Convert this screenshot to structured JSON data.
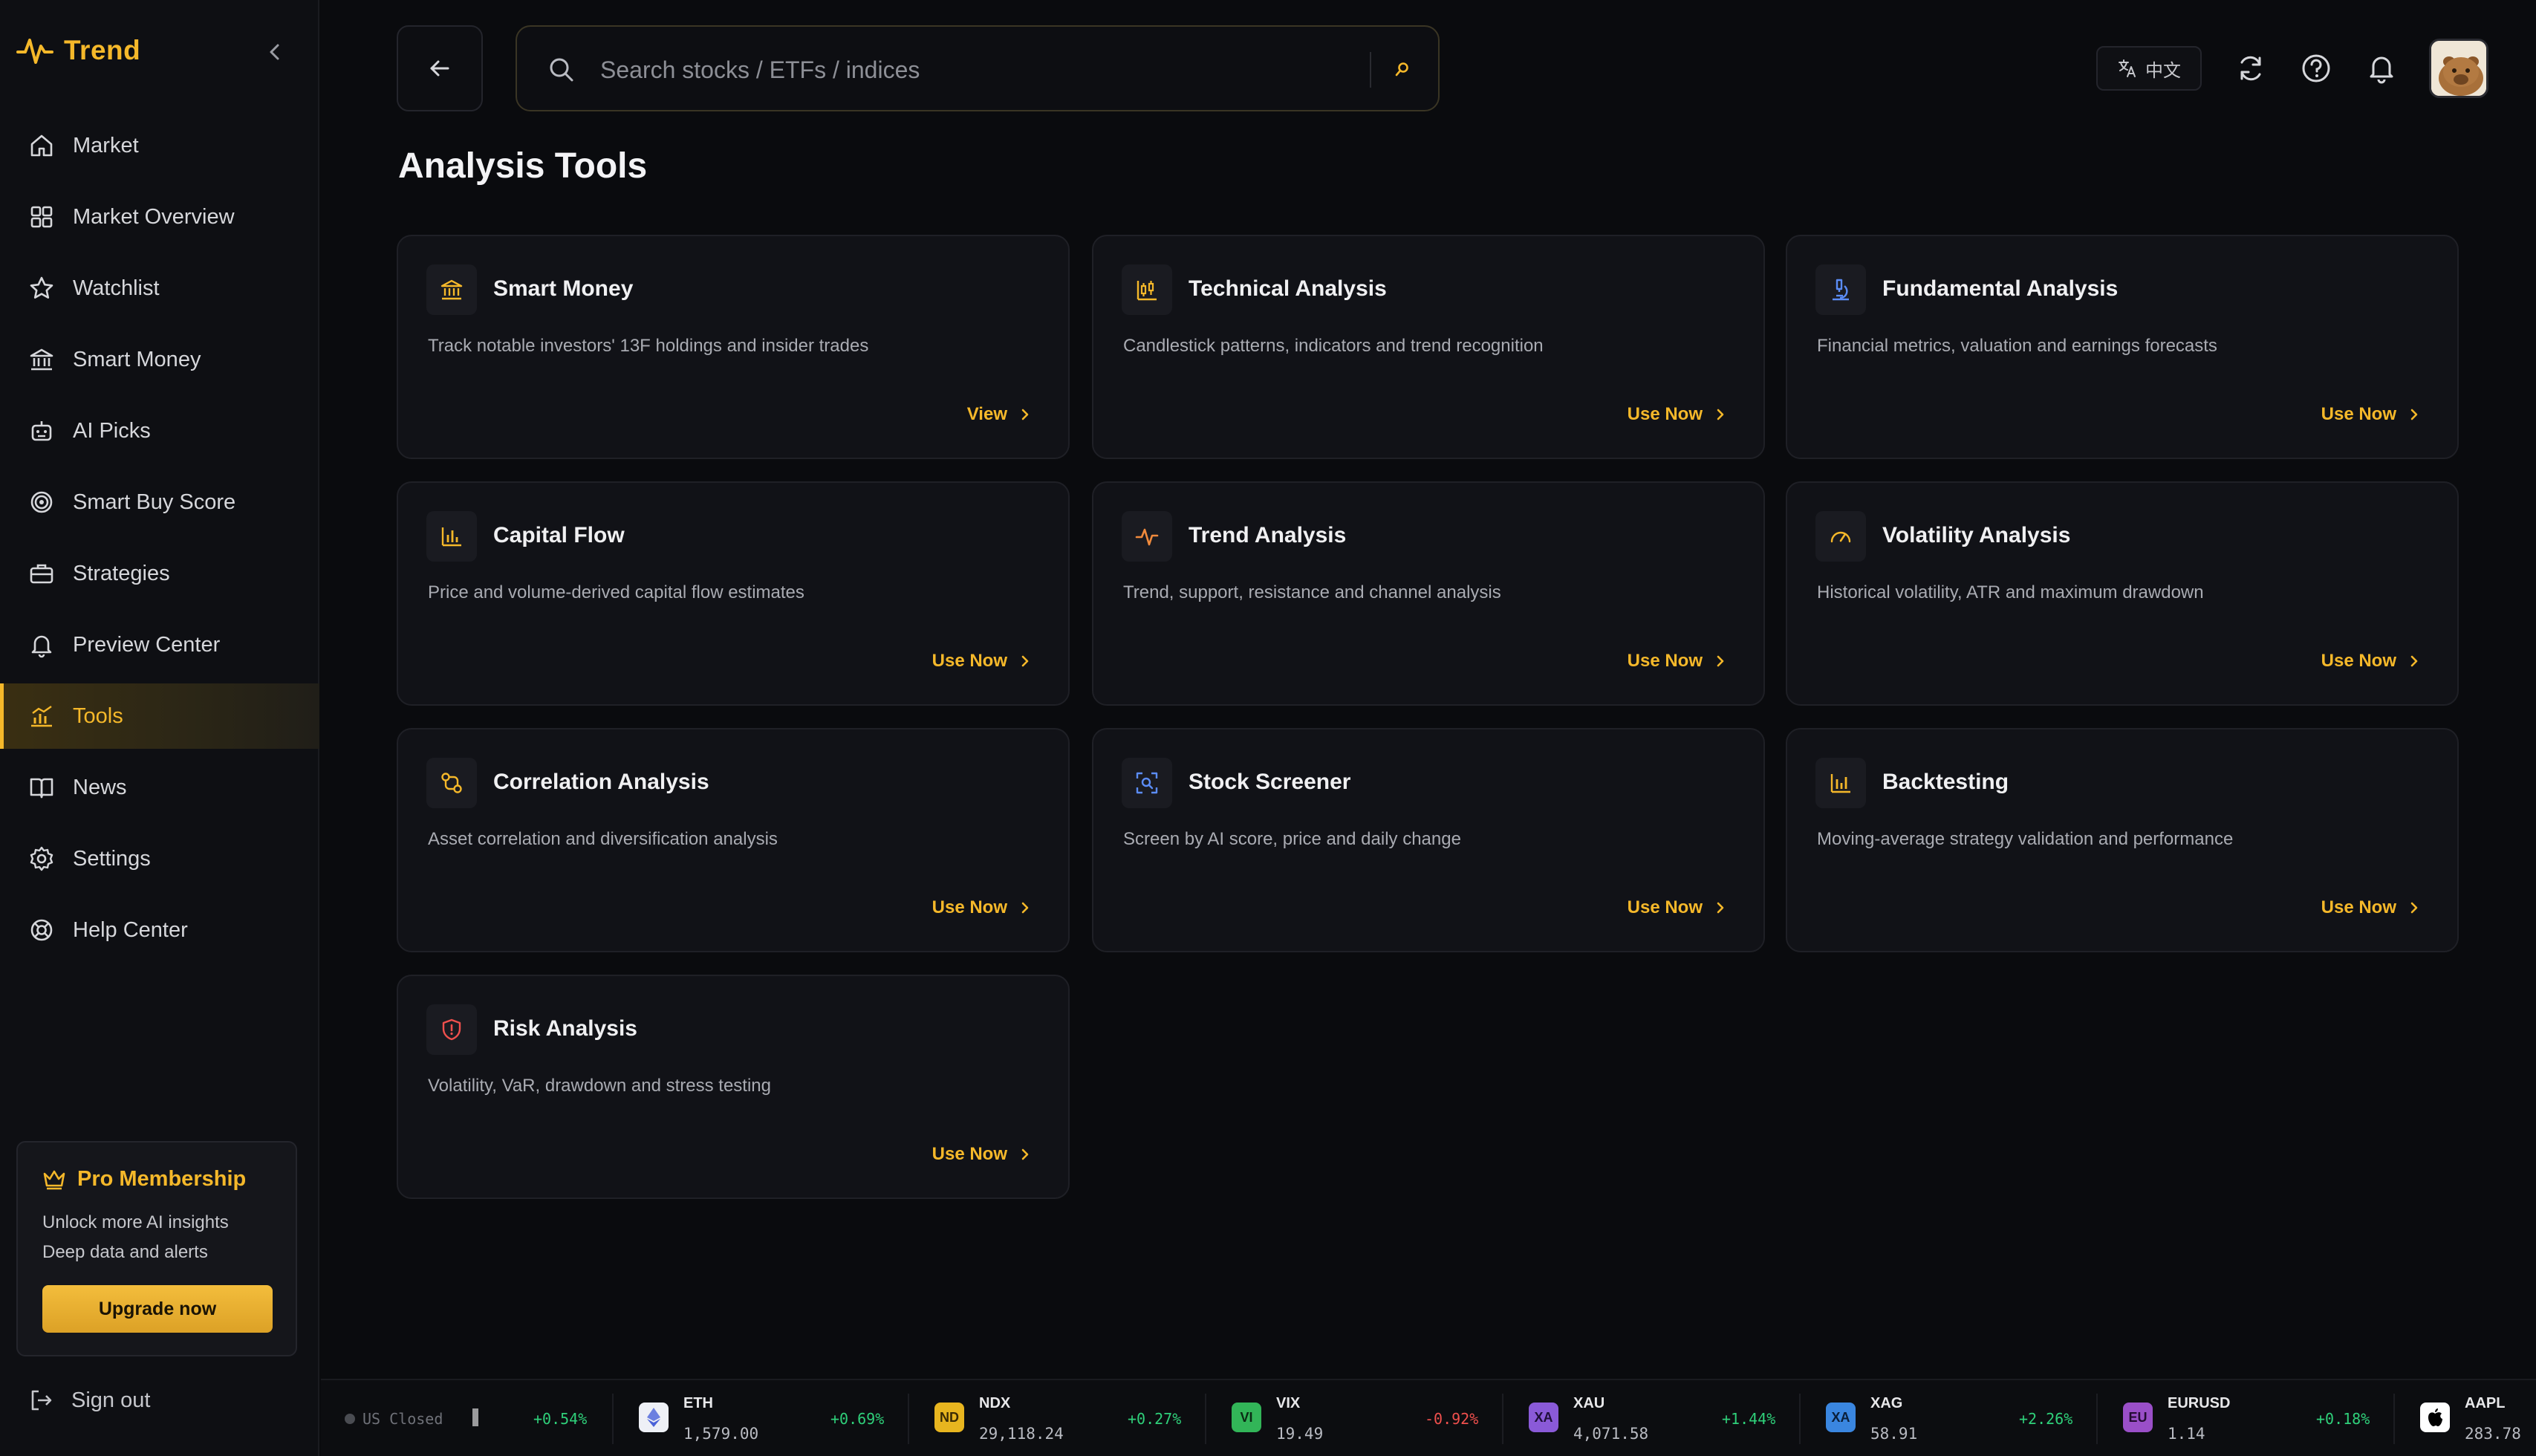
{
  "app": {
    "name": "Trend"
  },
  "sidebar": {
    "items": [
      {
        "label": "Market",
        "icon": "home-icon"
      },
      {
        "label": "Market Overview",
        "icon": "grid-icon"
      },
      {
        "label": "Watchlist",
        "icon": "star-icon"
      },
      {
        "label": "Smart Money",
        "icon": "bank-icon"
      },
      {
        "label": "AI Picks",
        "icon": "robot-icon"
      },
      {
        "label": "Smart Buy Score",
        "icon": "target-icon"
      },
      {
        "label": "Strategies",
        "icon": "briefcase-icon"
      },
      {
        "label": "Preview Center",
        "icon": "bell-icon"
      },
      {
        "label": "Tools",
        "icon": "chart-icon",
        "active": true
      },
      {
        "label": "News",
        "icon": "book-icon"
      },
      {
        "label": "Settings",
        "icon": "gear-icon"
      },
      {
        "label": "Help Center",
        "icon": "lifebuoy-icon"
      }
    ],
    "pro": {
      "title": "Pro Membership",
      "line1": "Unlock more AI insights",
      "line2": "Deep data and alerts",
      "button": "Upgrade now"
    },
    "signout": "Sign out"
  },
  "header": {
    "search_placeholder": "Search stocks / ETFs / indices",
    "lang_label": "中文"
  },
  "page": {
    "title": "Analysis Tools"
  },
  "tools": [
    {
      "title": "Smart Money",
      "desc": "Track notable investors' 13F holdings and insider trades",
      "action": "View",
      "icon": "bank-icon",
      "color": "#f5b82a"
    },
    {
      "title": "Technical Analysis",
      "desc": "Candlestick patterns, indicators and trend recognition",
      "action": "Use Now",
      "icon": "candlestick-icon",
      "color": "#f5b82a"
    },
    {
      "title": "Fundamental Analysis",
      "desc": "Financial metrics, valuation and earnings forecasts",
      "action": "Use Now",
      "icon": "microscope-icon",
      "color": "#5b8cf5"
    },
    {
      "title": "Capital Flow",
      "desc": "Price and volume-derived capital flow estimates",
      "action": "Use Now",
      "icon": "bar-chart-icon",
      "color": "#f5b82a"
    },
    {
      "title": "Trend Analysis",
      "desc": "Trend, support, resistance and channel analysis",
      "action": "Use Now",
      "icon": "pulse-icon",
      "color": "#f08a3c"
    },
    {
      "title": "Volatility Analysis",
      "desc": "Historical volatility, ATR and maximum drawdown",
      "action": "Use Now",
      "icon": "gauge-icon",
      "color": "#f5b82a"
    },
    {
      "title": "Correlation Analysis",
      "desc": "Asset correlation and diversification analysis",
      "action": "Use Now",
      "icon": "link-icon",
      "color": "#f5b82a"
    },
    {
      "title": "Stock Screener",
      "desc": "Screen by AI score, price and daily change",
      "action": "Use Now",
      "icon": "scan-icon",
      "color": "#5b8cf5"
    },
    {
      "title": "Backtesting",
      "desc": "Moving-average strategy validation and performance",
      "action": "Use Now",
      "icon": "bar-chart-icon",
      "color": "#f5b82a"
    },
    {
      "title": "Risk Analysis",
      "desc": "Volatility, VaR, drawdown and stress testing",
      "action": "Use Now",
      "icon": "shield-icon",
      "color": "#f0504d"
    }
  ],
  "ticker": {
    "status": "US Closed",
    "lead_change": "+0.54%",
    "items": [
      {
        "symbol": "ETH",
        "price": "1,579.00",
        "change": "+0.69%",
        "dir": "up",
        "badge": "",
        "badge_color": "#eef0f6",
        "badge_text_color": "#4a62d8"
      },
      {
        "symbol": "NDX",
        "price": "29,118.24",
        "change": "+0.27%",
        "dir": "up",
        "badge": "ND",
        "badge_color": "#e8b51f",
        "badge_text_color": "#3a2a05"
      },
      {
        "symbol": "VIX",
        "price": "19.49",
        "change": "-0.92%",
        "dir": "down",
        "badge": "VI",
        "badge_color": "#32b558",
        "badge_text_color": "#0b2a14"
      },
      {
        "symbol": "XAU",
        "price": "4,071.58",
        "change": "+1.44%",
        "dir": "up",
        "badge": "XA",
        "badge_color": "#8a5ad8",
        "badge_text_color": "#1f0f3a"
      },
      {
        "symbol": "XAG",
        "price": "58.91",
        "change": "+2.26%",
        "dir": "up",
        "badge": "XA",
        "badge_color": "#3a86e0",
        "badge_text_color": "#0a1f3a"
      },
      {
        "symbol": "EURUSD",
        "price": "1.14",
        "change": "+0.18%",
        "dir": "up",
        "badge": "EU",
        "badge_color": "#9a4fc8",
        "badge_text_color": "#240c33"
      },
      {
        "symbol": "AAPL",
        "price": "283.78",
        "change": "",
        "dir": "up",
        "badge": "",
        "badge_color": "#ffffff",
        "badge_text_color": "#000000"
      }
    ]
  },
  "colors": {
    "accent": "#f5b82a",
    "up": "#2fd07a",
    "down": "#f0504d",
    "background": "#0a0b0e"
  }
}
